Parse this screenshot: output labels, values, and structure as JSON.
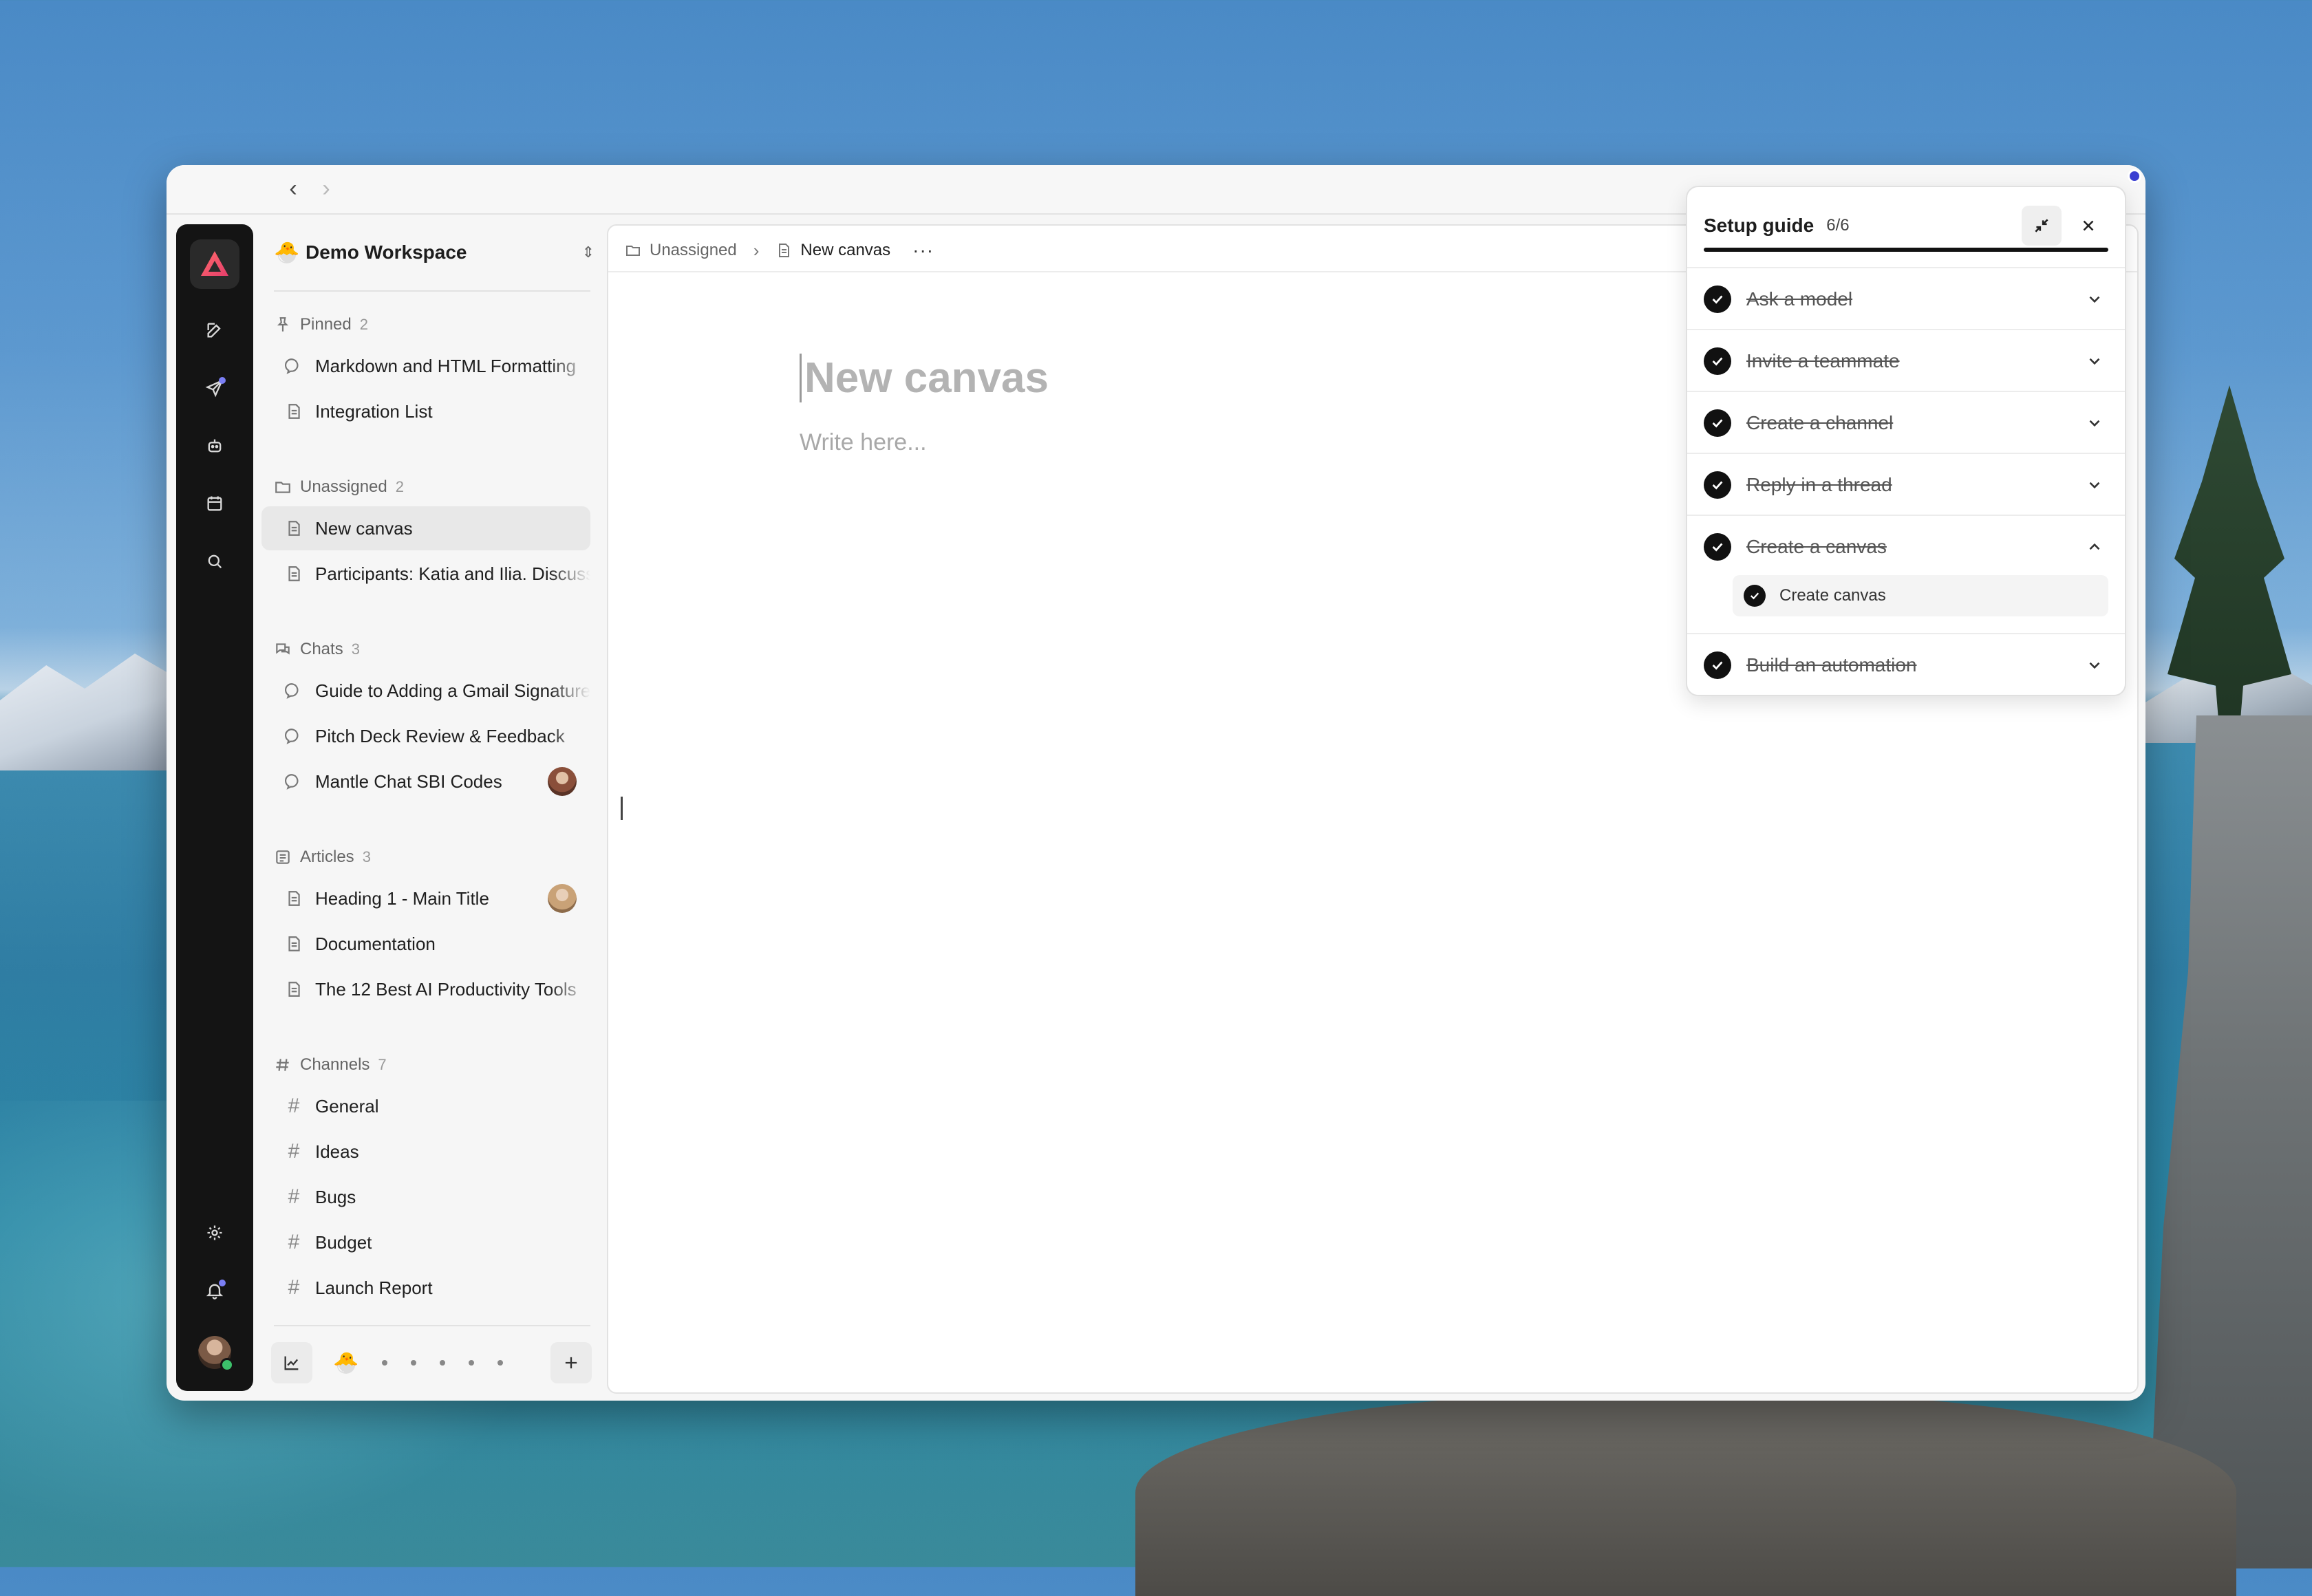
{
  "workspace": {
    "emoji": "🐣",
    "name": "Demo Workspace"
  },
  "sections": {
    "pinned": {
      "label": "Pinned",
      "count": "2",
      "items": [
        "Markdown and HTML Formatting",
        "Integration List"
      ]
    },
    "unassigned": {
      "label": "Unassigned",
      "count": "2",
      "items": [
        "New canvas",
        "Participants: Katia and Ilia. Discussion"
      ]
    },
    "chats": {
      "label": "Chats",
      "count": "3",
      "items": [
        "Guide to Adding a Gmail Signature",
        "Pitch Deck Review & Feedback",
        "Mantle Chat SBI Codes"
      ]
    },
    "articles": {
      "label": "Articles",
      "count": "3",
      "items": [
        "Heading 1 - Main Title",
        "Documentation",
        "The 12 Best AI Productivity Tools"
      ]
    },
    "channels": {
      "label": "Channels",
      "count": "7",
      "items": [
        "General",
        "Ideas",
        "Bugs",
        "Budget",
        "Launch Report"
      ]
    }
  },
  "breadcrumb": {
    "folder": "Unassigned",
    "current": "New canvas",
    "more": "···"
  },
  "canvas": {
    "title": "New canvas",
    "placeholder": "Write here..."
  },
  "setup_guide": {
    "title": "Setup guide",
    "count": "6/6",
    "progress": 1.0,
    "steps": [
      "Ask a model",
      "Invite a teammate",
      "Create a channel",
      "Reply in a thread",
      "Create a canvas",
      "Build an automation"
    ],
    "expanded_step": "Create a canvas",
    "sub_task": "Create canvas"
  },
  "bottom_bar": {
    "emoji": "🐣"
  }
}
